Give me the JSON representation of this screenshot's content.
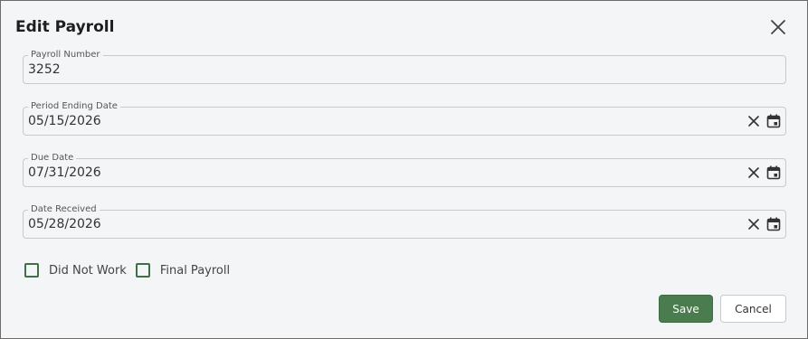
{
  "dialog": {
    "title": "Edit Payroll",
    "close_icon": "close-icon"
  },
  "fields": {
    "payroll_number": {
      "label": "Payroll Number",
      "value": "3252"
    },
    "period_ending_date": {
      "label": "Period Ending Date",
      "value": "05/15/2026",
      "clear_icon": "clear-icon",
      "calendar_icon": "calendar-icon"
    },
    "due_date": {
      "label": "Due Date",
      "value": "07/31/2026",
      "clear_icon": "clear-icon",
      "calendar_icon": "calendar-icon"
    },
    "date_received": {
      "label": "Date Received",
      "value": "05/28/2026",
      "clear_icon": "clear-icon",
      "calendar_icon": "calendar-icon"
    }
  },
  "checkboxes": {
    "did_not_work": {
      "label": "Did Not Work",
      "checked": false
    },
    "final_payroll": {
      "label": "Final Payroll",
      "checked": false
    }
  },
  "buttons": {
    "save_label": "Save",
    "cancel_label": "Cancel"
  },
  "colors": {
    "accent": "#4b7c4f",
    "background": "#f4f5f7",
    "border": "#c7c9cc"
  }
}
